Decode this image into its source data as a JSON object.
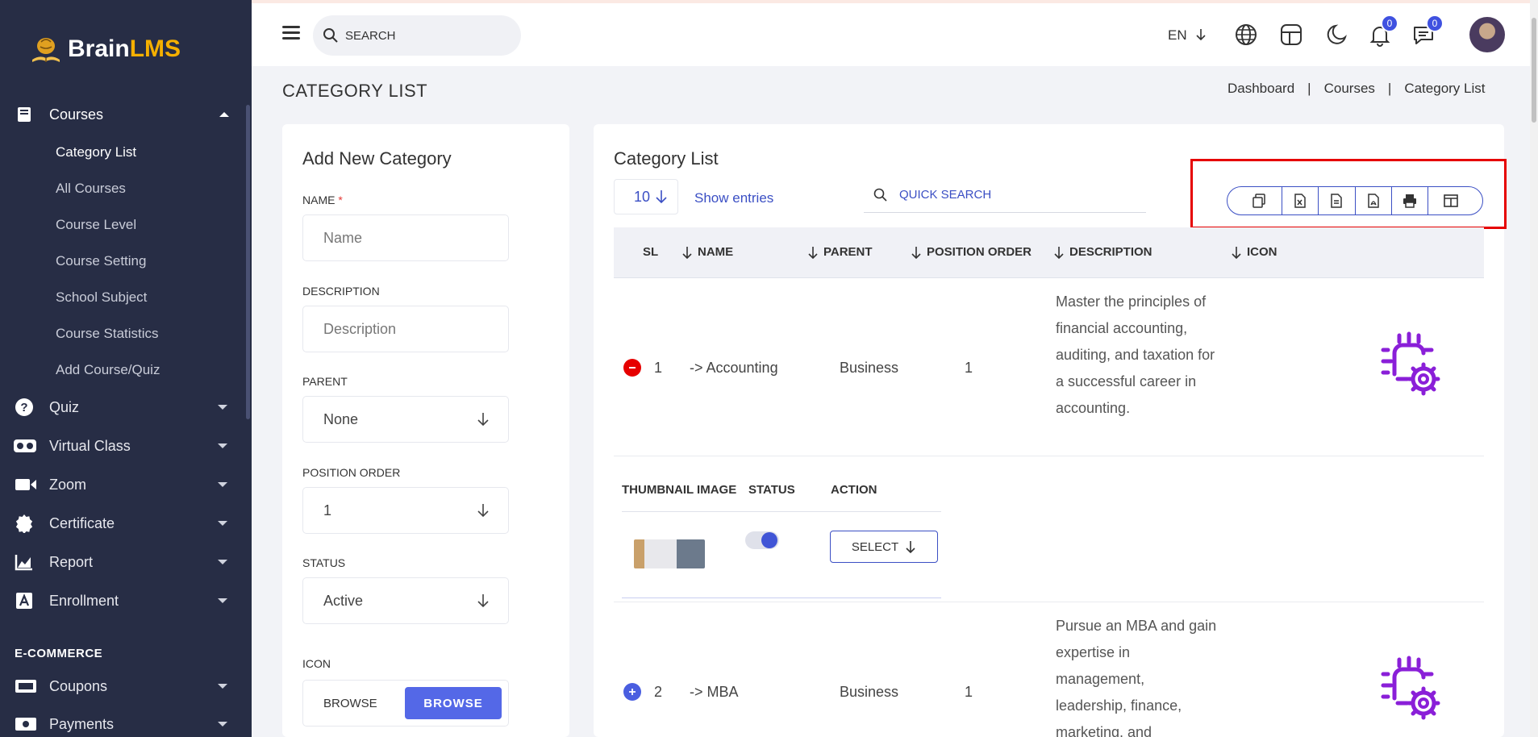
{
  "brand": {
    "name_part1": "Brain",
    "name_part2": "LMS"
  },
  "sidebar": {
    "courses": {
      "label": "Courses",
      "icon": "book-icon"
    },
    "sub_items": [
      {
        "label": "Category List",
        "active": true
      },
      {
        "label": "All Courses"
      },
      {
        "label": "Course Level"
      },
      {
        "label": "Course Setting"
      },
      {
        "label": "School Subject"
      },
      {
        "label": "Course Statistics"
      },
      {
        "label": "Add Course/Quiz"
      }
    ],
    "items": [
      {
        "label": "Quiz",
        "icon": "question-icon"
      },
      {
        "label": "Virtual Class",
        "icon": "vr-headset-icon"
      },
      {
        "label": "Zoom",
        "icon": "video-camera-icon"
      },
      {
        "label": "Certificate",
        "icon": "certificate-badge-icon"
      },
      {
        "label": "Report",
        "icon": "chart-icon"
      },
      {
        "label": "Enrollment",
        "icon": "enrollment-icon"
      }
    ],
    "section_label": "E-COMMERCE",
    "ecommerce_items": [
      {
        "label": "Coupons",
        "icon": "coupon-icon"
      },
      {
        "label": "Payments",
        "icon": "money-icon"
      }
    ]
  },
  "header": {
    "search_placeholder": "SEARCH",
    "language": "EN",
    "notifications_count": "0",
    "messages_count": "0"
  },
  "page": {
    "title": "CATEGORY LIST",
    "breadcrumb": [
      "Dashboard",
      "Courses",
      "Category List"
    ],
    "separator": "|"
  },
  "form": {
    "title": "Add New Category",
    "name_label": "NAME",
    "name_required": "*",
    "name_placeholder": "Name",
    "description_label": "DESCRIPTION",
    "description_placeholder": "Description",
    "parent_label": "PARENT",
    "parent_value": "None",
    "position_label": "POSITION ORDER",
    "position_value": "1",
    "status_label": "STATUS",
    "status_value": "Active",
    "icon_label": "ICON",
    "browse_text": "BROWSE",
    "browse_button": "BROWSE"
  },
  "list": {
    "title": "Category List",
    "entries": "10",
    "show_entries": "Show entries",
    "quick_search_placeholder": "QUICK SEARCH",
    "export_buttons": [
      "copy-icon",
      "excel-icon",
      "csv-icon",
      "pdf-icon",
      "print-icon",
      "columns-icon"
    ],
    "columns": {
      "sl": "SL",
      "name": "NAME",
      "parent": "PARENT",
      "position": "POSITION ORDER",
      "description": "DESCRIPTION",
      "icon": "ICON"
    },
    "child_columns": {
      "thumbnail": "THUMBNAIL IMAGE",
      "status": "STATUS",
      "action": "ACTION"
    },
    "select_label": "SELECT",
    "rows": [
      {
        "sl": "1",
        "name": "-> Accounting",
        "parent": "Business",
        "position": "1",
        "description": "Master the principles of financial accounting, auditing, and taxation for a successful career in accounting.",
        "expanded": true
      },
      {
        "sl": "2",
        "name": "-> MBA",
        "parent": "Business",
        "position": "1",
        "description": "Pursue an MBA and gain expertise in management, leadership, finance, marketing, and",
        "expanded": false
      }
    ]
  },
  "colors": {
    "sidebar": "#272d45",
    "accent": "#3b4fc4",
    "brand_yellow": "#f5b000",
    "collapse_red": "#e60000"
  }
}
